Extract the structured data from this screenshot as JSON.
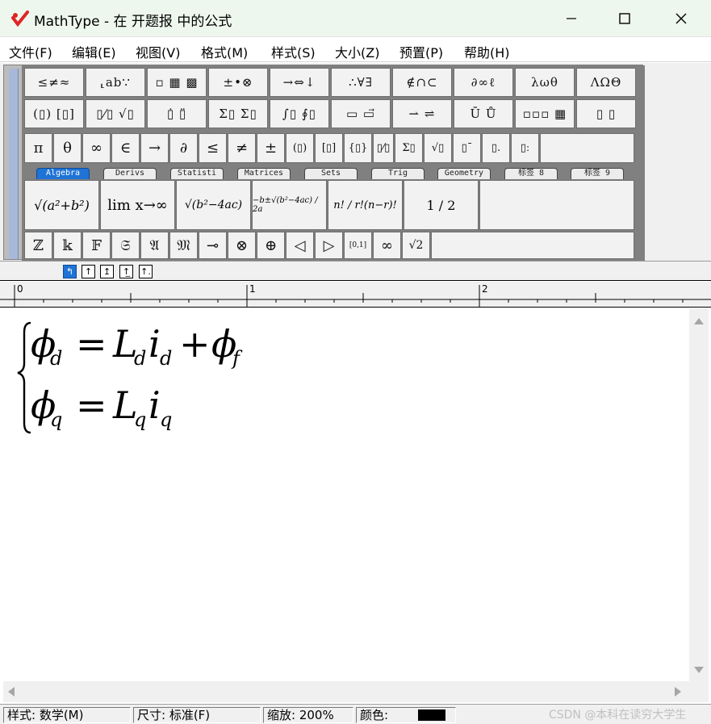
{
  "window": {
    "title": "MathType - 在 开题报 中的公式",
    "brand_color": "#e02424"
  },
  "menu": [
    {
      "label": "文件(F)"
    },
    {
      "label": "编辑(E)"
    },
    {
      "label": "视图(V)"
    },
    {
      "label": "格式(M)"
    },
    {
      "label": "样式(S)"
    },
    {
      "label": "大小(Z)"
    },
    {
      "label": "预置(P)"
    },
    {
      "label": "帮助(H)"
    }
  ],
  "palette_row1": [
    "≤≠≈",
    "⸤ab∵",
    "▫ ▦ ▩",
    "±•⊗",
    "→⇔↓",
    "∴∀∃",
    "∉∩⊂",
    "∂∞ℓ",
    "λωθ",
    "ΛΩΘ"
  ],
  "palette_row2": [
    "(▯) [▯]",
    "▯⁄▯ √▯",
    "▯̇ ▯̈",
    "Σ▯ Σ▯",
    "∫▯ ∮▯",
    "▭ ▭⃗",
    "⇀ ⇌",
    "Ū Ů",
    "▫▫▫ ▦",
    "▯ ▯"
  ],
  "palette_row3": [
    "π",
    "θ",
    "∞",
    "∈",
    "→",
    "∂",
    "≤",
    "≠",
    "±",
    "(▯)",
    "[▯]",
    "{▯}",
    "▯⁄▯",
    "Σ▯",
    "√▯",
    "▯ˉ",
    "▯.",
    "▯ː"
  ],
  "tabs": [
    {
      "label": "Algebra",
      "active": true
    },
    {
      "label": "Derivs",
      "active": false
    },
    {
      "label": "Statisti",
      "active": false
    },
    {
      "label": "Matrices",
      "active": false
    },
    {
      "label": "Sets",
      "active": false
    },
    {
      "label": "Trig",
      "active": false
    },
    {
      "label": "Geometry",
      "active": false
    },
    {
      "label": "标签 8",
      "active": false
    },
    {
      "label": "标签 9",
      "active": false
    }
  ],
  "templates": [
    {
      "label": "√(a²+b²)"
    },
    {
      "label": "lim x→∞"
    },
    {
      "label": "√(b²−4ac)"
    },
    {
      "label": "−b±√(b²−4ac) / 2a"
    },
    {
      "label": "n! / r!(n−r)!"
    },
    {
      "label": "1 / 2"
    }
  ],
  "palette_row5": [
    "ℤ",
    "𝕜",
    "𝔽",
    "𝔖",
    "𝔄",
    "𝔐",
    "⊸",
    "⊗",
    "⊕",
    "◁",
    "▷",
    "[0,1]",
    "∞",
    "√2"
  ],
  "mini_toolbar": [
    "↰",
    "↑",
    "↥",
    "↑̲",
    "↑."
  ],
  "ruler": {
    "marks": [
      "0",
      "1",
      "2"
    ]
  },
  "equation": {
    "line1": {
      "lhs": "ϕ",
      "lhs_sub": "d",
      "eq": "=",
      "t1": "L",
      "t1_sub": "d",
      "t2": "i",
      "t2_sub": "d",
      "plus": "+",
      "t3": "ϕ",
      "t3_sub": "f"
    },
    "line2": {
      "lhs": "ϕ",
      "lhs_sub": "q",
      "eq": "=",
      "t1": "L",
      "t1_sub": "q",
      "t2": "i",
      "t2_sub": "q"
    }
  },
  "status": {
    "style": "样式: 数学(M)",
    "size": "尺寸: 标准(F)",
    "zoom": "缩放: 200%",
    "color_label": "颜色:",
    "color_value": "#000000"
  },
  "watermark": "CSDN @本科在读穷大学生"
}
